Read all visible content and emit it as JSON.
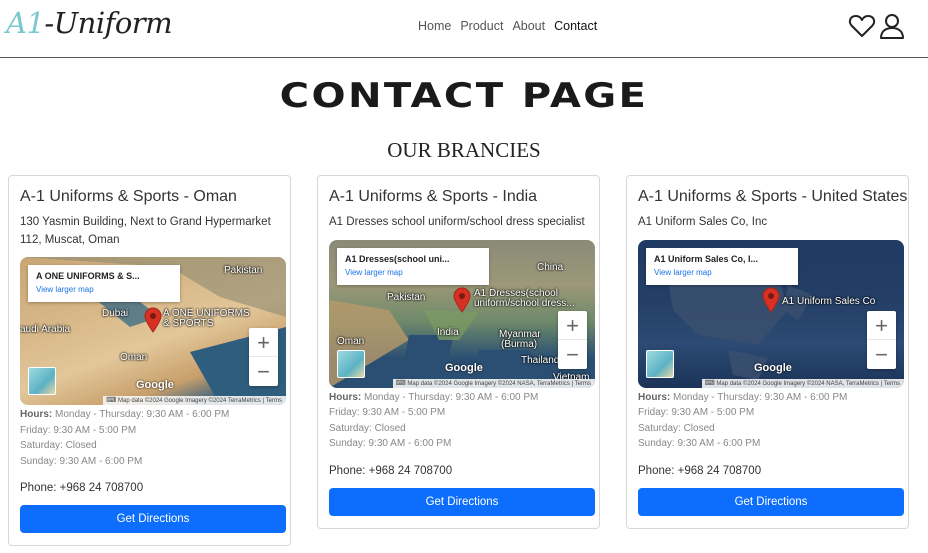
{
  "brand": {
    "logo_part1": "A1",
    "logo_part2": "-Uniform"
  },
  "nav": {
    "items": [
      "Home",
      "Product",
      "About",
      "Contact"
    ],
    "active": "Contact"
  },
  "icons": {
    "wishlist": "heart-icon",
    "account": "user-icon"
  },
  "page": {
    "title": "CONTACT PAGE",
    "branches_heading": "OUR BRANCIES"
  },
  "branches": [
    {
      "title": "A-1 Uniforms & Sports - Oman",
      "address_line1": "130 Yasmin Building, Next to Grand Hypermarket",
      "address_line2": "112, Muscat, Oman",
      "map": {
        "info_title": "A ONE UNIFORMS & S...",
        "info_link": "View larger map",
        "labels": [
          "Pakistan",
          "Dubai",
          "audi Arabia",
          "Oman",
          "A ONE UNIFORMS",
          "& SPORTS"
        ],
        "attribution": "Map data ©2024 Google Imagery ©2024 TerraMetrics",
        "terms": "Terms",
        "google": "Google"
      },
      "hours_label": "Hours:",
      "hours": [
        "Monday - Thursday: 9:30 AM - 6:00 PM",
        "Friday: 9:30 AM - 5:00 PM",
        "Saturday: Closed",
        "Sunday: 9:30 AM - 6:00 PM"
      ],
      "phone": "Phone: +968 24 708700",
      "button": "Get Directions"
    },
    {
      "title": "A-1 Uniforms & Sports - India",
      "address_line1": "A1 Dresses school uniform/school dress specialist",
      "address_line2": "",
      "map": {
        "info_title": "A1 Dresses(school uni...",
        "info_link": "View larger map",
        "labels": [
          "China",
          "Pakistan",
          "India",
          "Oman",
          "Myanmar",
          "(Burma)",
          "Thailand",
          "Vietnam",
          "A1 Dresses(school",
          "uniform/school dress..."
        ],
        "attribution": "Map data ©2024 Google Imagery ©2024 NASA, TerraMetrics",
        "terms": "Terms",
        "google": "Google"
      },
      "hours_label": "Hours:",
      "hours": [
        "Monday - Thursday: 9:30 AM - 6:00 PM",
        "Friday: 9:30 AM - 5:00 PM",
        "Saturday: Closed",
        "Sunday: 9:30 AM - 6:00 PM"
      ],
      "phone": "Phone: +968 24 708700",
      "button": "Get Directions"
    },
    {
      "title": "A-1 Uniforms & Sports - United States",
      "address_line1": "A1 Uniform Sales Co, Inc",
      "address_line2": "",
      "map": {
        "info_title": "A1 Uniform Sales Co, I...",
        "info_link": "View larger map",
        "labels": [
          "A1 Uniform Sales Co"
        ],
        "attribution": "Map data ©2024 Google Imagery ©2024 NASA, TerraMetrics",
        "terms": "Terms",
        "google": "Google"
      },
      "hours_label": "Hours:",
      "hours": [
        "Monday - Thursday: 9:30 AM - 6:00 PM",
        "Friday: 9:30 AM - 5:00 PM",
        "Saturday: Closed",
        "Sunday: 9:30 AM - 6:00 PM"
      ],
      "phone": "Phone: +968 24 708700",
      "button": "Get Directions"
    }
  ],
  "colors": {
    "button_bg": "#0d6efd",
    "logo_accent": "#79c9cf",
    "pin": "#d93025",
    "desert": "#d8b98a",
    "sea": "#2f5d7e",
    "terrain": "#8e9a74",
    "night": "#243f66"
  }
}
